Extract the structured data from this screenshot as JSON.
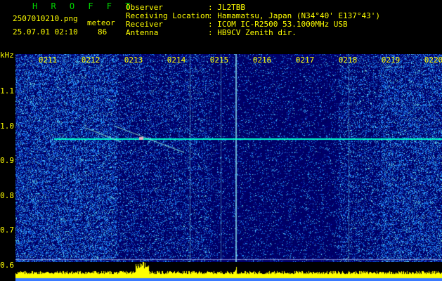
{
  "header": {
    "title": "H R O F F T",
    "filename": "2507010210.png",
    "datetime": "25.07.01 02:10",
    "meteor_label": "meteor",
    "meteor_count": "86"
  },
  "info": {
    "observer_label": "Observer",
    "observer_value": ": JL2TBB",
    "location_label": "Receiving Location",
    "location_value": ": Hamamatsu, Japan (N34°40' E137°43')",
    "receiver_label": "Receiver",
    "receiver_value": ": ICOM IC-R2500 53.1000MHz USB",
    "antenna_label": "Antenna",
    "antenna_value": ": HB9CV Zenith dir."
  },
  "axis": {
    "freq_unit": "kHz",
    "freq_ticks": [
      "1.1",
      "1.0",
      "0.9",
      "0.8",
      "0.7",
      "0.6"
    ],
    "time_ticks": [
      "0211",
      "0212",
      "0213",
      "0214",
      "0215",
      "0216",
      "0217",
      "0218",
      "0219",
      "0220"
    ]
  },
  "colors": {
    "text_yellow": "#ffff00",
    "title_green": "#00d800",
    "noise_dark": "#00006a",
    "noise_light": "#2a6aff",
    "carrier": "#00ffcc"
  }
}
